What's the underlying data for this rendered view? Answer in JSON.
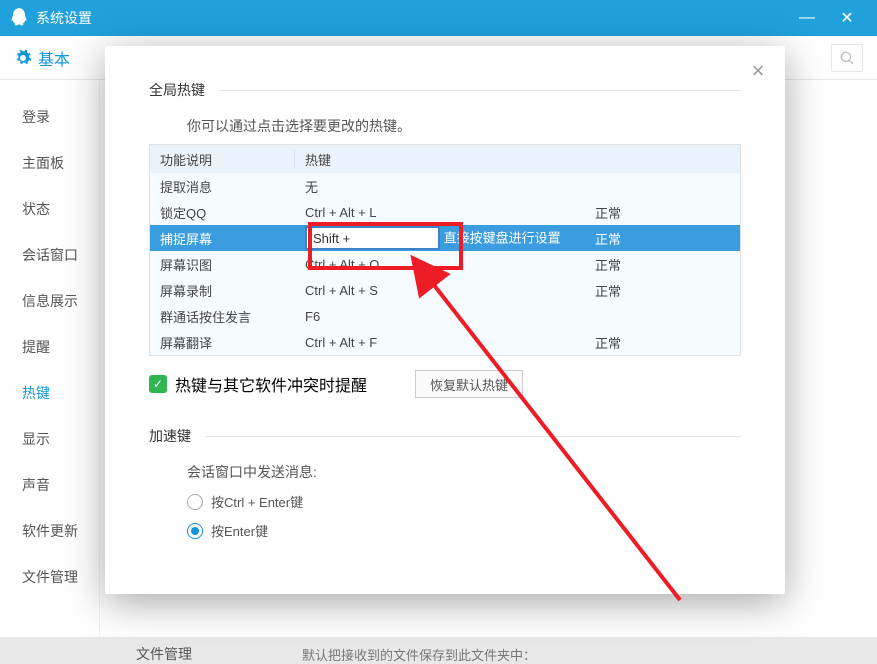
{
  "titlebar": {
    "title": "系统设置"
  },
  "tabbar": {
    "basic": "基本",
    "search_placeholder": ""
  },
  "sidebar": {
    "items": [
      {
        "label": "登录"
      },
      {
        "label": "主面板"
      },
      {
        "label": "状态"
      },
      {
        "label": "会话窗口"
      },
      {
        "label": "信息展示"
      },
      {
        "label": "提醒"
      },
      {
        "label": "热键"
      },
      {
        "label": "显示"
      },
      {
        "label": "声音"
      },
      {
        "label": "软件更新"
      },
      {
        "label": "文件管理"
      }
    ]
  },
  "main": {
    "file_label": "文件管理",
    "file_desc": "默认把接收到的文件保存到此文件夹中："
  },
  "dialog": {
    "section_global": "全局热键",
    "hint": "你可以通过点击选择要更改的热键。",
    "columns": {
      "func": "功能说明",
      "hotkey": "热键"
    },
    "rows": [
      {
        "func": "提取消息",
        "key": "无",
        "status": ""
      },
      {
        "func": "锁定QQ",
        "key": "Ctrl + Alt + L",
        "status": "正常"
      },
      {
        "func": "捕捉屏幕",
        "key": "Shift + ",
        "hint": "直接按键盘进行设置",
        "status": "正常"
      },
      {
        "func": "屏幕识图",
        "key": "Ctrl + Alt + O",
        "status": "正常"
      },
      {
        "func": "屏幕录制",
        "key": "Ctrl + Alt + S",
        "status": "正常"
      },
      {
        "func": "群通话按住发言",
        "key": "F6",
        "status": ""
      },
      {
        "func": "屏幕翻译",
        "key": "Ctrl + Alt + F",
        "status": "正常"
      }
    ],
    "conflict_label": "热键与其它软件冲突时提醒",
    "restore_button": "恢复默认热键",
    "section_accel": "加速键",
    "send_label": "会话窗口中发送消息:",
    "opt_ctrl_enter": "按Ctrl + Enter键",
    "opt_enter": "按Enter键"
  }
}
